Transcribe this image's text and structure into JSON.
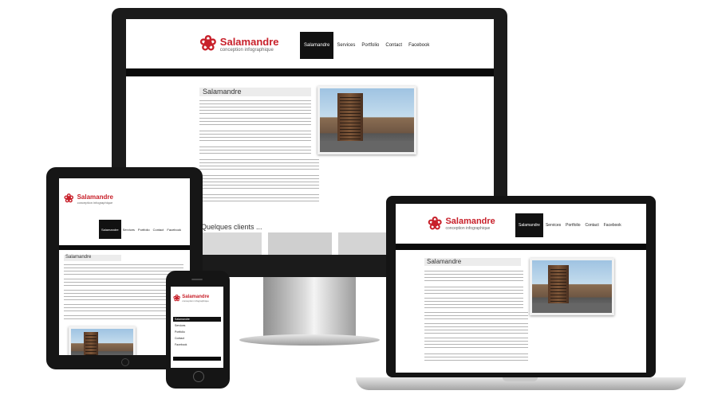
{
  "site": {
    "logo_title": "Salamandre",
    "logo_subtitle": "conception infographique",
    "nav": [
      "Salamandre",
      "Services",
      "Portfolio",
      "Contact",
      "Facebook"
    ],
    "page_heading": "Salamandre",
    "clients_heading": "Quelques clients ...",
    "brand_color": "#c8202a",
    "nav_active_color": "#111111"
  },
  "devices": [
    "desktop-monitor",
    "tablet",
    "laptop",
    "smartphone"
  ],
  "icons": {
    "logo": "salamander-flower-logo"
  }
}
